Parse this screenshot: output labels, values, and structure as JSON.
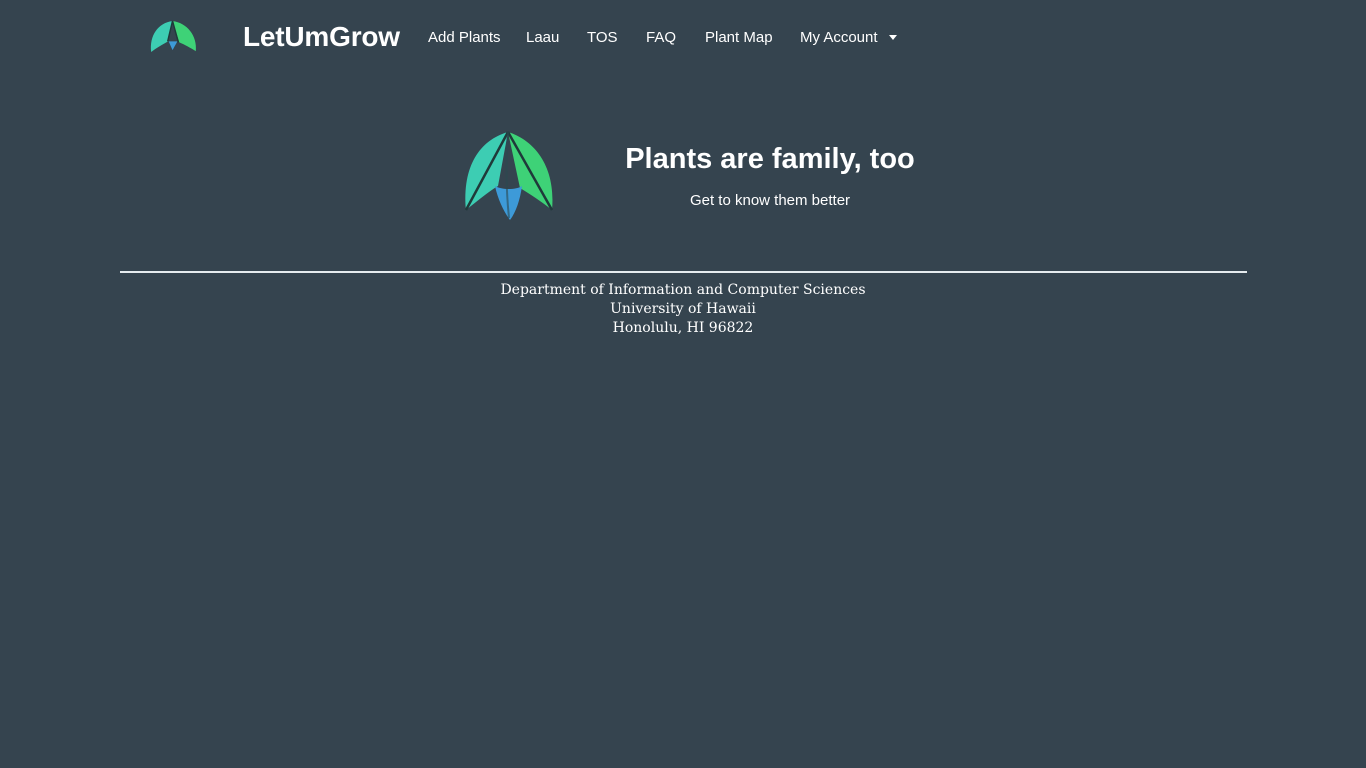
{
  "navbar": {
    "brand": "LetUmGrow",
    "logo_icon": "leaf-logo-icon",
    "links": [
      {
        "label": "Add Plants"
      },
      {
        "label": "Laau"
      },
      {
        "label": "TOS"
      },
      {
        "label": "FAQ"
      },
      {
        "label": "Plant Map"
      }
    ],
    "account": {
      "label": "My Account",
      "icon": "chevron-down-icon"
    }
  },
  "hero": {
    "logo_icon": "leaf-logo-icon",
    "title": "Plants are family, too",
    "subtitle": "Get to know them better"
  },
  "footer": {
    "lines": [
      "Department of Information and Computer Sciences",
      "University of Hawaii",
      "Honolulu, HI 96822"
    ]
  },
  "colors": {
    "background": "#35444f",
    "leaf_teal": "#3dcdb3",
    "leaf_green": "#3ed277",
    "leaf_blue": "#3d9ad8",
    "text": "#ffffff"
  }
}
